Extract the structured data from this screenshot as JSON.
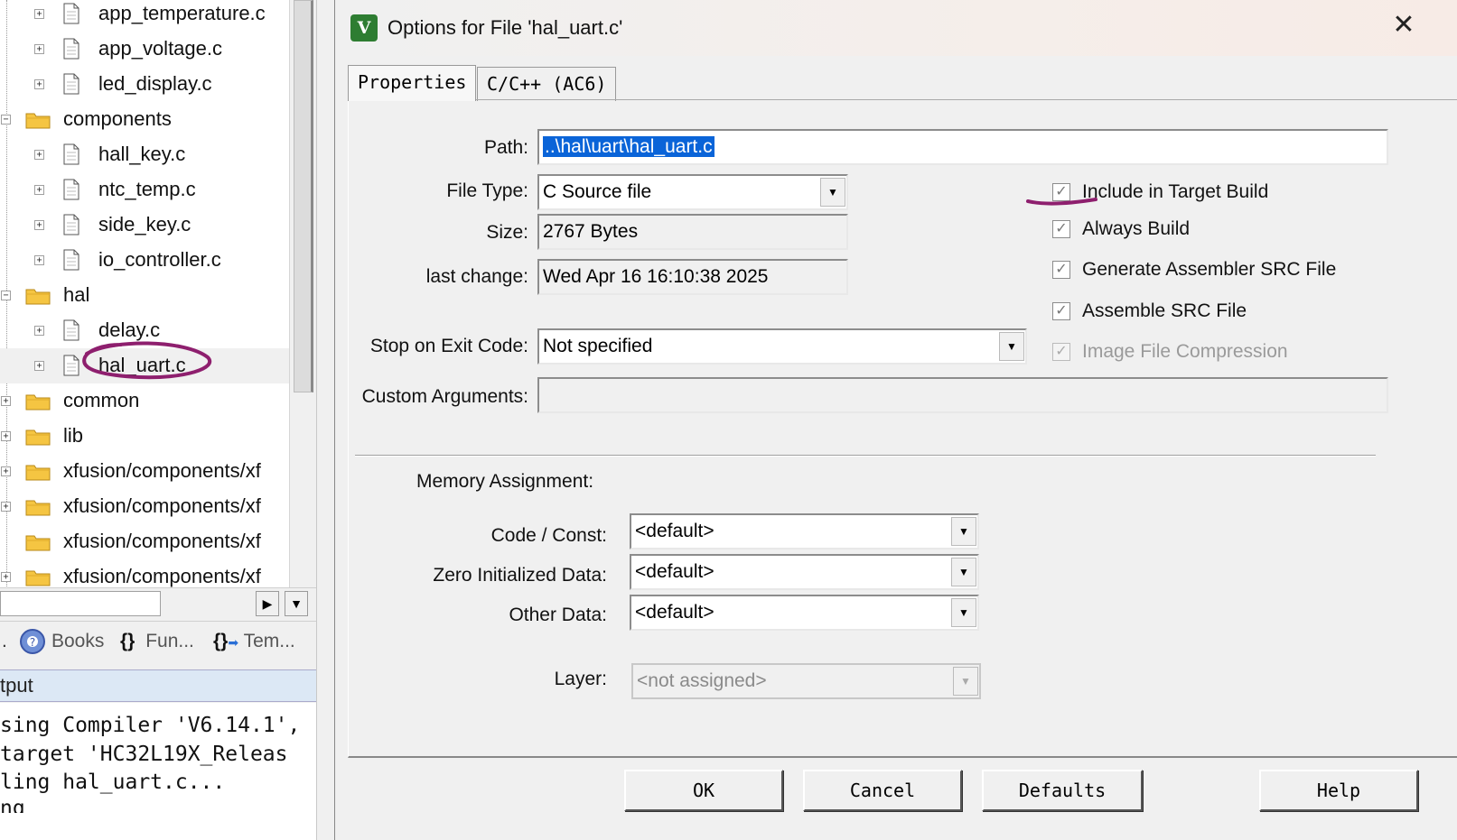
{
  "tree": {
    "items": [
      {
        "label": "app_temperature.c",
        "type": "file"
      },
      {
        "label": "app_voltage.c",
        "type": "file"
      },
      {
        "label": "led_display.c",
        "type": "file"
      },
      {
        "label": "components",
        "type": "folder",
        "expander": "−"
      },
      {
        "label": "hall_key.c",
        "type": "file"
      },
      {
        "label": "ntc_temp.c",
        "type": "file"
      },
      {
        "label": "side_key.c",
        "type": "file"
      },
      {
        "label": "io_controller.c",
        "type": "file"
      },
      {
        "label": "hal",
        "type": "folder",
        "expander": "−"
      },
      {
        "label": "delay.c",
        "type": "file"
      },
      {
        "label": "hal_uart.c",
        "type": "file",
        "selected": true
      },
      {
        "label": "common",
        "type": "folder",
        "expander": "+"
      },
      {
        "label": "lib",
        "type": "folder",
        "expander": "+"
      },
      {
        "label": "xfusion/components/xf",
        "type": "folder",
        "expander": "+"
      },
      {
        "label": "xfusion/components/xf",
        "type": "folder",
        "expander": "+"
      },
      {
        "label": "xfusion/components/xf",
        "type": "folder",
        "expander": ""
      },
      {
        "label": "xfusion/components/xf",
        "type": "folder",
        "expander": "+"
      }
    ]
  },
  "bottom_tabs": {
    "books": "Books",
    "functions": "Fun...",
    "functions_icon": "{}",
    "templates": "Tem...",
    "templates_icon": "{}"
  },
  "output": {
    "header": "tput",
    "lines": [
      "sing Compiler 'V6.14.1',",
      " target 'HC32L19X_Releas",
      "ling hal_uart.c...",
      "ng"
    ]
  },
  "dialog": {
    "title": "Options for File 'hal_uart.c'",
    "app_icon_letter": "V",
    "close_glyph": "✕",
    "tabs": [
      "Properties",
      "C/C++ (AC6)"
    ],
    "path_label": "Path:",
    "path_value": "..\\hal\\uart\\hal_uart.c",
    "file_type_label": "File Type:",
    "file_type_value": "C Source file",
    "size_label": "Size:",
    "size_value": "2767 Bytes",
    "last_change_label": "last change:",
    "last_change_value": "Wed Apr 16 16:10:38 2025",
    "stop_on_exit_label": "Stop on Exit Code:",
    "stop_on_exit_value": "Not specified",
    "custom_args_label": "Custom Arguments:",
    "custom_args_value": "",
    "checkboxes": [
      {
        "label": "Include in Target Build",
        "checked": true,
        "enabled": true
      },
      {
        "label": "Always Build",
        "checked": true,
        "enabled": true
      },
      {
        "label": "Generate Assembler SRC File",
        "checked": true,
        "enabled": true
      },
      {
        "label": "Assemble SRC File",
        "checked": true,
        "enabled": true
      },
      {
        "label": "Image File Compression",
        "checked": true,
        "enabled": false
      }
    ],
    "memory_heading": "Memory Assignment:",
    "code_const_label": "Code / Const:",
    "code_const_value": "<default>",
    "zero_init_label": "Zero Initialized Data:",
    "zero_init_value": "<default>",
    "other_data_label": "Other Data:",
    "other_data_value": "<default>",
    "layer_label": "Layer:",
    "layer_value": "<not assigned>",
    "buttons": {
      "ok": "OK",
      "cancel": "Cancel",
      "defaults": "Defaults",
      "help": "Help"
    }
  },
  "annotation_color": "#8e1f6e",
  "selection_color": "#0a64d8"
}
